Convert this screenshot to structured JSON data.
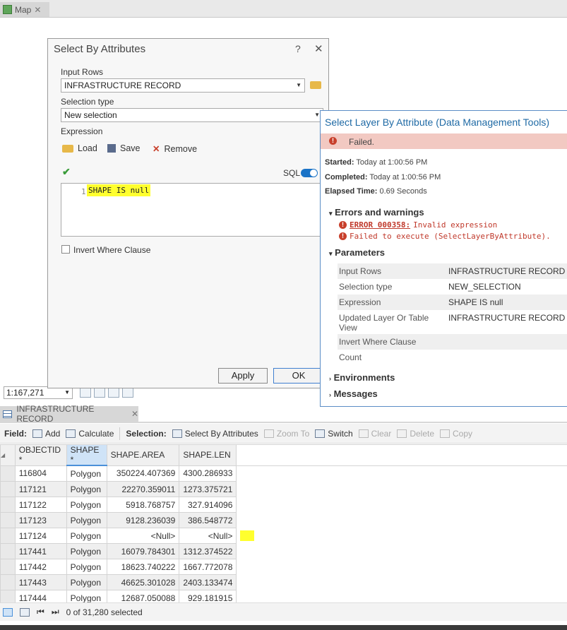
{
  "map_tab": {
    "label": "Map"
  },
  "scale": {
    "value": "1:167,271"
  },
  "dialog": {
    "title": "Select By Attributes",
    "help": "?",
    "input_rows_label": "Input Rows",
    "input_rows_value": "INFRASTRUCTURE RECORD",
    "selection_type_label": "Selection type",
    "selection_type_value": "New selection",
    "expression_label": "Expression",
    "load": "Load",
    "save": "Save",
    "remove": "Remove",
    "sql_label": "SQL",
    "line_number": "1",
    "expression_text": "SHAPE IS null",
    "invert_label": "Invert Where Clause",
    "apply": "Apply",
    "ok": "OK"
  },
  "popup": {
    "title": "Select Layer By Attribute (Data Management Tools)",
    "status": "Failed.",
    "started_label": "Started:",
    "started": "Today at 1:00:56 PM",
    "completed_label": "Completed:",
    "completed": "Today at 1:00:56 PM",
    "elapsed_label": "Elapsed Time:",
    "elapsed": "0.69 Seconds",
    "errors_heading": "Errors and warnings",
    "error1_code": "ERROR 000358:",
    "error1_msg": "Invalid expression",
    "error2_msg": "Failed to execute (SelectLayerByAttribute).",
    "params_heading": "Parameters",
    "params": [
      {
        "k": "Input Rows",
        "v": "INFRASTRUCTURE RECORD"
      },
      {
        "k": "Selection type",
        "v": "NEW_SELECTION"
      },
      {
        "k": "Expression",
        "v": "SHAPE IS null"
      },
      {
        "k": "Updated Layer Or Table View",
        "v": "INFRASTRUCTURE RECORD"
      },
      {
        "k": "Invert Where Clause",
        "v": ""
      },
      {
        "k": "Count",
        "v": ""
      }
    ],
    "environments": "Environments",
    "messages": "Messages"
  },
  "table_tab": {
    "label": "INFRASTRUCTURE RECORD"
  },
  "toolbar": {
    "field_label": "Field:",
    "add": "Add",
    "calculate": "Calculate",
    "selection_label": "Selection:",
    "select_by_attributes": "Select By Attributes",
    "zoom_to": "Zoom To",
    "switch": "Switch",
    "clear": "Clear",
    "delete": "Delete",
    "copy": "Copy"
  },
  "table": {
    "columns": [
      "OBJECTID *",
      "SHAPE *",
      "SHAPE.AREA",
      "SHAPE.LEN"
    ],
    "rows": [
      [
        "116804",
        "Polygon",
        "350224.407369",
        "4300.286933"
      ],
      [
        "117121",
        "Polygon",
        "22270.359011",
        "1273.375721"
      ],
      [
        "117122",
        "Polygon",
        "5918.768757",
        "327.914096"
      ],
      [
        "117123",
        "Polygon",
        "9128.236039",
        "386.548772"
      ],
      [
        "117124",
        "Polygon",
        "<Null>",
        "<Null>"
      ],
      [
        "117441",
        "Polygon",
        "16079.784301",
        "1312.374522"
      ],
      [
        "117442",
        "Polygon",
        "18623.740222",
        "1667.772078"
      ],
      [
        "117443",
        "Polygon",
        "46625.301028",
        "2403.133474"
      ],
      [
        "117444",
        "Polygon",
        "12687.050088",
        "929.181915"
      ]
    ]
  },
  "status": {
    "selected": "0 of 31,280 selected"
  }
}
